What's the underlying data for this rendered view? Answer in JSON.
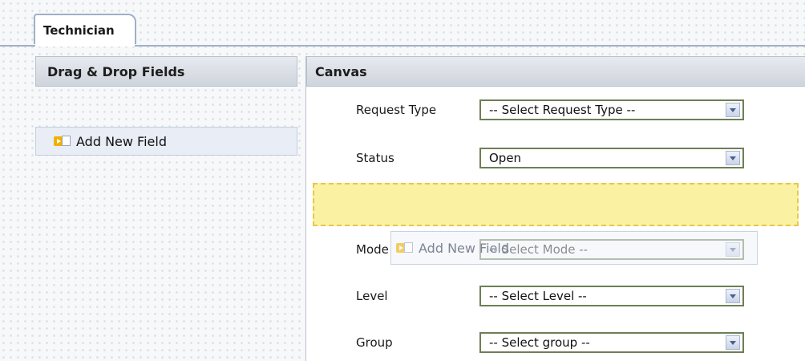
{
  "tabs": [
    {
      "label": "Technician",
      "active": true
    }
  ],
  "left_panel": {
    "title": "Drag & Drop Fields",
    "add_field_label": "Add New Field",
    "add_field_icon": "add-field-icon"
  },
  "canvas": {
    "title": "Canvas",
    "fields": [
      {
        "label": "Request Type",
        "value": "-- Select Request Type --"
      },
      {
        "label": "Status",
        "value": "Open"
      },
      {
        "label": "Mode",
        "value": "-- Select Mode --"
      },
      {
        "label": "Level",
        "value": "-- Select Level --"
      },
      {
        "label": "Group",
        "value": "-- Select group --"
      }
    ],
    "dragging_label": "Add New Field"
  },
  "colors": {
    "drop_zone": "#fbf1a3",
    "select_border": "#6d7f56",
    "tab_border": "#9fb0c8"
  }
}
